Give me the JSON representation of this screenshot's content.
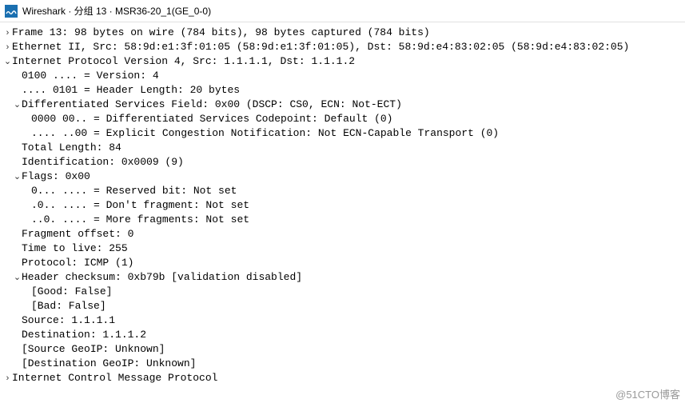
{
  "window": {
    "title": "Wireshark · 分组 13 · MSR36-20_1(GE_0-0)"
  },
  "tree": [
    {
      "depth": 0,
      "twisty": "closed",
      "text": "Frame 13: 98 bytes on wire (784 bits), 98 bytes captured (784 bits)"
    },
    {
      "depth": 0,
      "twisty": "closed",
      "text": "Ethernet II, Src: 58:9d:e1:3f:01:05 (58:9d:e1:3f:01:05), Dst: 58:9d:e4:83:02:05 (58:9d:e4:83:02:05)"
    },
    {
      "depth": 0,
      "twisty": "open",
      "text": "Internet Protocol Version 4, Src: 1.1.1.1, Dst: 1.1.1.2"
    },
    {
      "depth": 1,
      "twisty": "none",
      "text": "0100 .... = Version: 4"
    },
    {
      "depth": 1,
      "twisty": "none",
      "text": ".... 0101 = Header Length: 20 bytes"
    },
    {
      "depth": 1,
      "twisty": "open",
      "text": "Differentiated Services Field: 0x00 (DSCP: CS0, ECN: Not-ECT)"
    },
    {
      "depth": 2,
      "twisty": "none",
      "text": "0000 00.. = Differentiated Services Codepoint: Default (0)"
    },
    {
      "depth": 2,
      "twisty": "none",
      "text": ".... ..00 = Explicit Congestion Notification: Not ECN-Capable Transport (0)"
    },
    {
      "depth": 1,
      "twisty": "none",
      "text": "Total Length: 84"
    },
    {
      "depth": 1,
      "twisty": "none",
      "text": "Identification: 0x0009 (9)"
    },
    {
      "depth": 1,
      "twisty": "open",
      "text": "Flags: 0x00"
    },
    {
      "depth": 2,
      "twisty": "none",
      "text": "0... .... = Reserved bit: Not set"
    },
    {
      "depth": 2,
      "twisty": "none",
      "text": ".0.. .... = Don't fragment: Not set"
    },
    {
      "depth": 2,
      "twisty": "none",
      "text": "..0. .... = More fragments: Not set"
    },
    {
      "depth": 1,
      "twisty": "none",
      "text": "Fragment offset: 0"
    },
    {
      "depth": 1,
      "twisty": "none",
      "text": "Time to live: 255"
    },
    {
      "depth": 1,
      "twisty": "none",
      "text": "Protocol: ICMP (1)"
    },
    {
      "depth": 1,
      "twisty": "open",
      "text": "Header checksum: 0xb79b [validation disabled]"
    },
    {
      "depth": 2,
      "twisty": "none",
      "text": "[Good: False]"
    },
    {
      "depth": 2,
      "twisty": "none",
      "text": "[Bad: False]"
    },
    {
      "depth": 1,
      "twisty": "none",
      "text": "Source: 1.1.1.1"
    },
    {
      "depth": 1,
      "twisty": "none",
      "text": "Destination: 1.1.1.2"
    },
    {
      "depth": 1,
      "twisty": "none",
      "text": "[Source GeoIP: Unknown]"
    },
    {
      "depth": 1,
      "twisty": "none",
      "text": "[Destination GeoIP: Unknown]"
    },
    {
      "depth": 0,
      "twisty": "closed",
      "text": "Internet Control Message Protocol"
    }
  ],
  "watermark": "@51CTO博客"
}
